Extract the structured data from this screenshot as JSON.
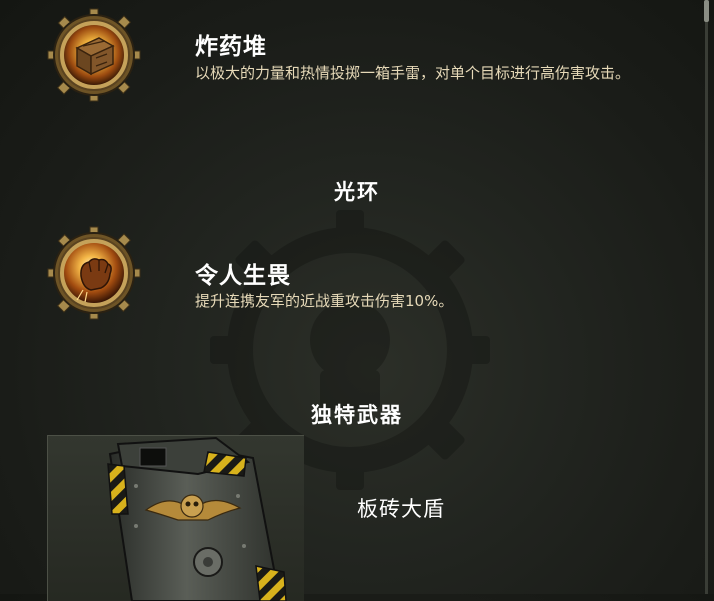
{
  "abilities": [
    {
      "title": "炸药堆",
      "description": "以极大的力量和热情投掷一箱手雷，对单个目标进行高伤害攻击。",
      "icon": "explosive-crate-icon"
    }
  ],
  "aura_section": {
    "heading": "光环"
  },
  "auras": [
    {
      "title": "令人生畏",
      "description": "提升连携友军的近战重攻击伤害10%。",
      "icon": "raised-fist-icon"
    }
  ],
  "weapon_section": {
    "heading": "独特武器",
    "weapon_name": "板砖大盾",
    "weapon_icon": "tower-shield-image"
  },
  "colors": {
    "background": "#1e201c",
    "title_text": "#ffffff",
    "description_text": "#e6d9b8",
    "icon_gold": "#c99a3c",
    "hazard_yellow": "#d8b21c"
  }
}
